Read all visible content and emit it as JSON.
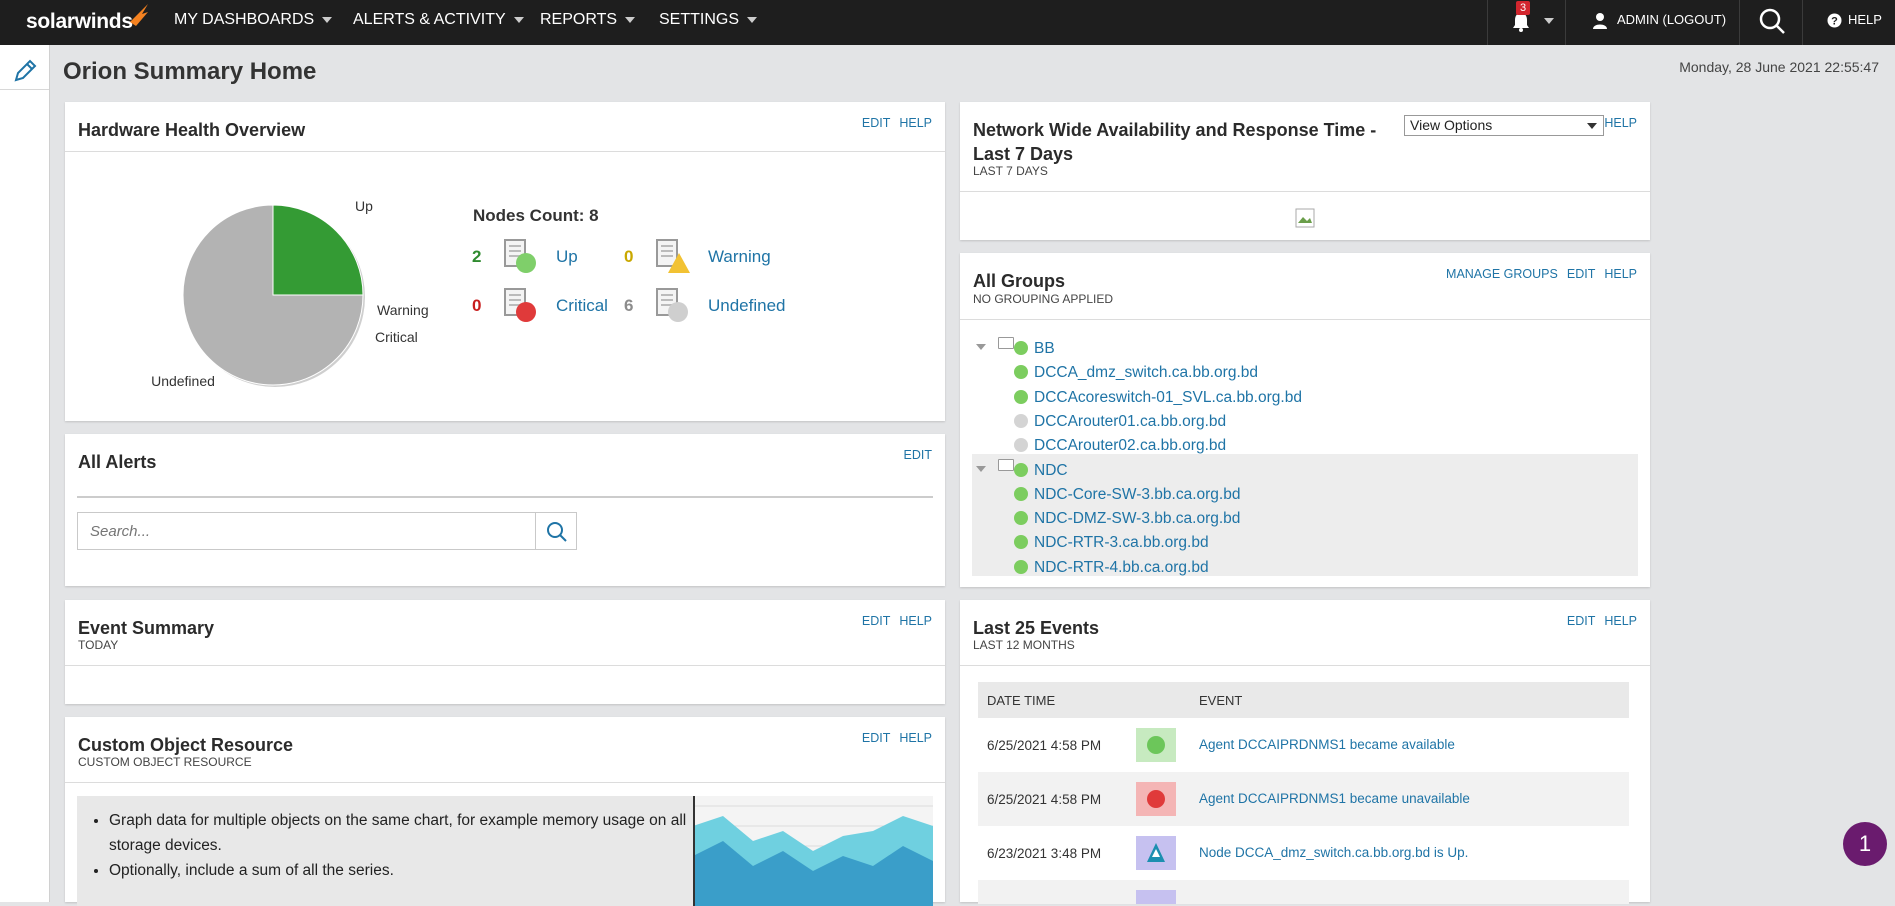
{
  "nav": {
    "logo": "solarwinds",
    "items": [
      "MY DASHBOARDS",
      "ALERTS & ACTIVITY",
      "REPORTS",
      "SETTINGS"
    ],
    "notification_count": "3",
    "admin": "ADMIN (LOGOUT)",
    "help": "HELP"
  },
  "page": {
    "title": "Orion Summary Home",
    "datetime": "Monday, 28 June 2021 22:55:47"
  },
  "hardware": {
    "title": "Hardware Health Overview",
    "links": [
      "EDIT",
      "HELP"
    ],
    "nodes_count": "Nodes Count: 8",
    "pie_labels": {
      "up": "Up",
      "warning": "Warning",
      "critical": "Critical",
      "undefined": "Undefined"
    },
    "legend": [
      {
        "count": "2",
        "label": "Up",
        "color": "#2f8b2f",
        "dot": "#7fcf6a"
      },
      {
        "count": "0",
        "label": "Warning",
        "color": "#c9a800",
        "dot": "#f2c233"
      },
      {
        "count": "0",
        "label": "Critical",
        "color": "#c81e1e",
        "dot": "#e03a3a"
      },
      {
        "count": "6",
        "label": "Undefined",
        "color": "#8c8c8c",
        "dot": "#cfcfcf"
      }
    ],
    "chart_data": {
      "type": "pie",
      "categories": [
        "Up",
        "Warning",
        "Critical",
        "Undefined"
      ],
      "values": [
        2,
        0,
        0,
        6
      ],
      "colors": [
        "#349b34",
        "#f2c233",
        "#e03a3a",
        "#b3b3b3"
      ]
    }
  },
  "alerts": {
    "title": "All Alerts",
    "links": [
      "EDIT"
    ],
    "search_placeholder": "Search..."
  },
  "events_summary": {
    "title": "Event Summary",
    "subtitle": "TODAY",
    "links": [
      "EDIT",
      "HELP"
    ]
  },
  "custom": {
    "title": "Custom Object Resource",
    "subtitle": "CUSTOM OBJECT RESOURCE",
    "links": [
      "EDIT",
      "HELP"
    ],
    "bullets": [
      "Graph data for multiple objects on the same chart, for example memory usage on all storage devices.",
      "Optionally, include a sum of all the series."
    ]
  },
  "network": {
    "title": "Network Wide Availability and Response Time - Last 7 Days",
    "subtitle": "LAST 7 DAYS",
    "view_options": "View Options",
    "links": [
      "HELP"
    ]
  },
  "groups": {
    "title": "All Groups",
    "subtitle": "NO GROUPING APPLIED",
    "links": [
      "MANAGE GROUPS",
      "EDIT",
      "HELP"
    ],
    "tree": [
      {
        "label": "BB",
        "type": "group",
        "status": "#7ccd5f"
      },
      {
        "label": "DCCA_dmz_switch.ca.bb.org.bd",
        "type": "node",
        "status": "#7ccd5f"
      },
      {
        "label": "DCCAcoreswitch-01_SVL.ca.bb.org.bd",
        "type": "node",
        "status": "#7ccd5f"
      },
      {
        "label": "DCCArouter01.ca.bb.org.bd",
        "type": "node",
        "status": "#d4d4d4"
      },
      {
        "label": "DCCArouter02.ca.bb.org.bd",
        "type": "node",
        "status": "#d4d4d4"
      },
      {
        "label": "NDC",
        "type": "group",
        "status": "#7ccd5f"
      },
      {
        "label": "NDC-Core-SW-3.bb.ca.org.bd",
        "type": "node",
        "status": "#7ccd5f"
      },
      {
        "label": "NDC-DMZ-SW-3.bb.ca.org.bd",
        "type": "node",
        "status": "#7ccd5f"
      },
      {
        "label": "NDC-RTR-3.ca.bb.org.bd",
        "type": "node",
        "status": "#7ccd5f"
      },
      {
        "label": "NDC-RTR-4.bb.ca.org.bd",
        "type": "node",
        "status": "#7ccd5f"
      }
    ]
  },
  "last_events": {
    "title": "Last 25 Events",
    "subtitle": "LAST 12 MONTHS",
    "links": [
      "EDIT",
      "HELP"
    ],
    "columns": [
      "DATE TIME",
      "EVENT"
    ],
    "rows": [
      {
        "time": "6/25/2021 4:58 PM",
        "event": "Agent DCCAIPRDNMS1 became available",
        "icon": "green-dot-icon"
      },
      {
        "time": "6/25/2021 4:58 PM",
        "event": "Agent DCCAIPRDNMS1 became unavailable",
        "icon": "red-dot-icon"
      },
      {
        "time": "6/23/2021 3:48 PM",
        "event": "Node DCCA_dmz_switch.ca.bb.org.bd is Up.",
        "icon": "node-up-icon"
      }
    ]
  },
  "chat": {
    "count": "1"
  }
}
